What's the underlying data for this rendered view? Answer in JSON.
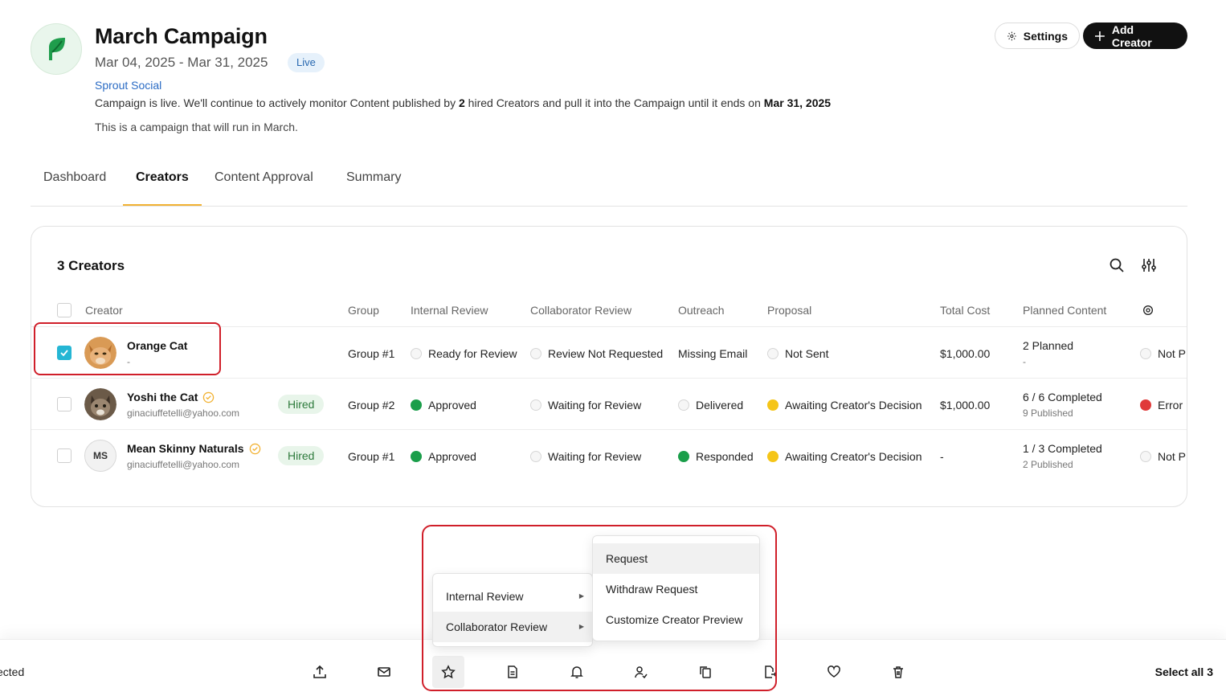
{
  "campaign": {
    "title": "March Campaign",
    "dates": "Mar 04, 2025 - Mar 31, 2025",
    "status": "Live",
    "brand": "Sprout Social",
    "live_desc_part1": "Campaign is live. We'll continue to actively monitor Content published by ",
    "live_desc_count": "2",
    "live_desc_part2": " hired Creators and pull it into the Campaign until it ends on ",
    "live_desc_end": "Mar 31, 2025",
    "description": "This is a campaign that will run in March."
  },
  "header_buttons": {
    "settings": "Settings",
    "add_creator": "Add Creator"
  },
  "tabs": [
    "Dashboard",
    "Creators",
    "Content Approval",
    "Summary"
  ],
  "table": {
    "title": "3 Creators",
    "columns": [
      "Creator",
      "Group",
      "Internal Review",
      "Collaborator Review",
      "Outreach",
      "Proposal",
      "Total Cost",
      "Planned Content"
    ],
    "rows": [
      {
        "name": "Orange Cat",
        "email": "-",
        "badge": "",
        "group": "Group #1",
        "internal": "Ready for Review",
        "collab": "Review Not Requested",
        "outreach": "Missing Email",
        "proposal": "Not Sent",
        "cost": "$1,000.00",
        "planned": "2 Planned",
        "planned_sub": "-",
        "last": "Not P"
      },
      {
        "name": "Yoshi the Cat",
        "email": "ginaciuffetelli@yahoo.com",
        "badge": "Hired",
        "group": "Group #2",
        "internal": "Approved",
        "collab": "Waiting for Review",
        "outreach": "Delivered",
        "proposal": "Awaiting Creator's Decision",
        "cost": "$1,000.00",
        "planned": "6 / 6 Completed",
        "planned_sub": "9 Published",
        "last": "Error"
      },
      {
        "name": "Mean Skinny Naturals",
        "initials": "MS",
        "email": "ginaciuffetelli@yahoo.com",
        "badge": "Hired",
        "group": "Group #1",
        "internal": "Approved",
        "collab": "Waiting for Review",
        "outreach": "Responded",
        "proposal": "Awaiting Creator's Decision",
        "cost": "-",
        "planned": "1 / 3 Completed",
        "planned_sub": "2 Published",
        "last": "Not P"
      }
    ]
  },
  "toolbar": {
    "selected": "ected",
    "select_all": "Select all 3"
  },
  "menu": {
    "items": [
      "Internal Review",
      "Collaborator Review"
    ],
    "submenu": [
      "Request",
      "Withdraw Request",
      "Customize Creator Preview"
    ]
  },
  "colors": {
    "accent": "#f2b233",
    "checkbox": "#25b6d4",
    "highlight": "#d01f2a",
    "approved": "#1a9e4a",
    "awaiting": "#f5c518",
    "error": "#e03a3a"
  }
}
